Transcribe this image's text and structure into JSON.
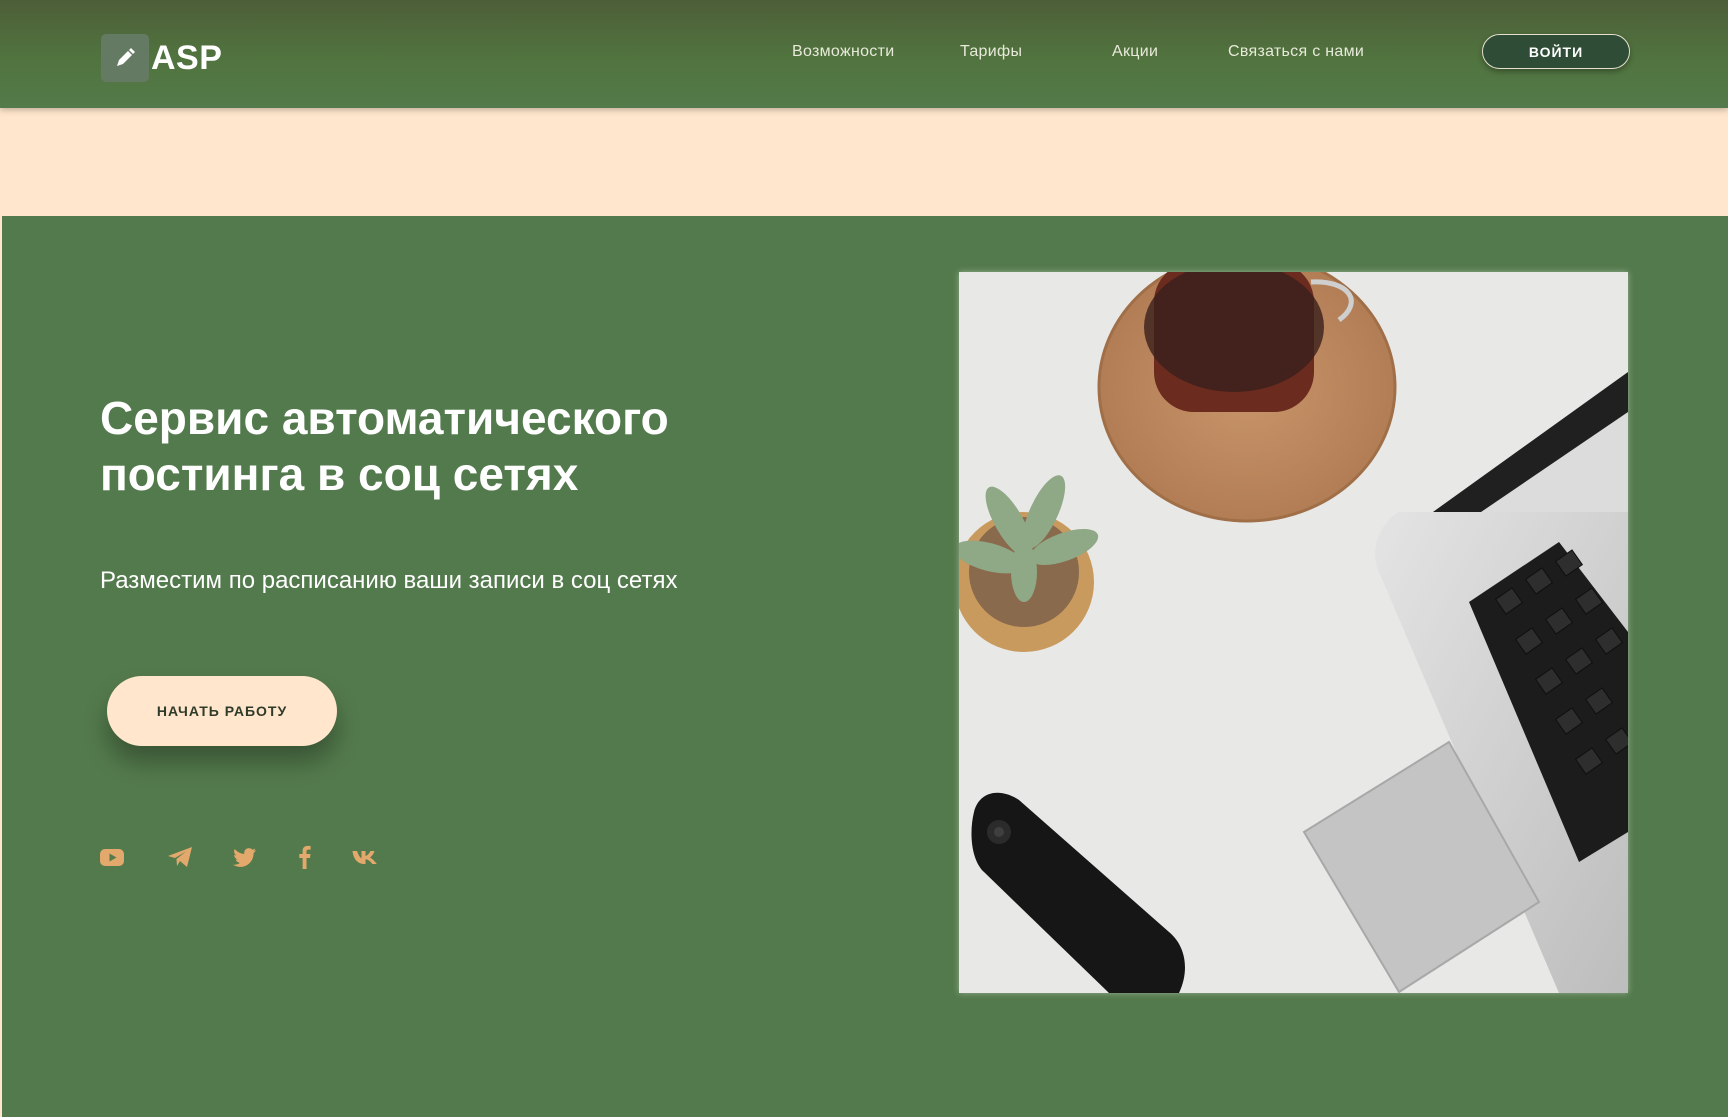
{
  "header": {
    "logo_text": "ASP",
    "nav": [
      "Возможности",
      "Тарифы",
      "Акции",
      "Связаться с нами"
    ],
    "login_label": "ВОЙТИ"
  },
  "hero": {
    "title": "Сервис автоматического постинга в соц сетях",
    "subtitle": "Разместим по расписанию ваши записи в соц сетях",
    "cta_label": "НАЧАТЬ РАБОТУ",
    "socials": [
      "youtube-icon",
      "telegram-icon",
      "twitter-icon",
      "facebook-icon",
      "vk-icon"
    ],
    "image": "desk-laptop-coffee-photo"
  },
  "colors": {
    "header_bg": "#51743f",
    "hero_bg": "#537a4c",
    "band_bg": "#ffe6cc",
    "accent": "#e3a96c",
    "cta_bg": "#ffe6cc"
  }
}
